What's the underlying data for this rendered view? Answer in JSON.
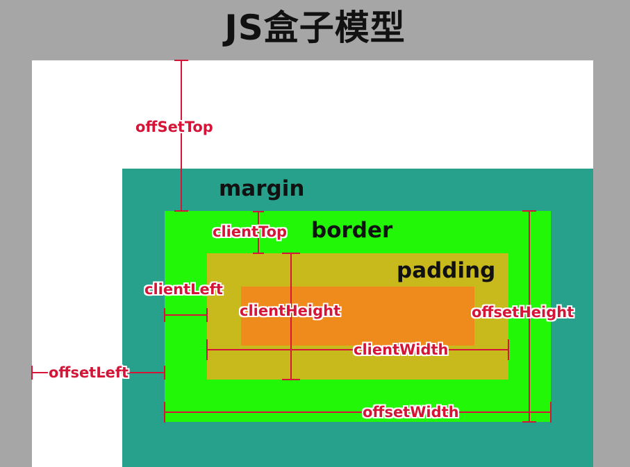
{
  "title": "JS盒子模型",
  "regions": {
    "margin": "margin",
    "border": "border",
    "padding": "padding"
  },
  "measurements": {
    "offset_top": "offSetTop",
    "client_top": "clientTop",
    "client_left": "clientLeft",
    "client_height": "clientHeight",
    "offset_height": "offsetHeight",
    "client_width": "clientWidth",
    "offset_left": "offsetLeft",
    "offset_width": "offsetWidth"
  },
  "colors": {
    "background": "#a6a6a6",
    "document": "#ffffff",
    "margin": "#27a18c",
    "border": "#22f707",
    "padding": "#c8b91c",
    "content": "#ef8a1d",
    "measure_line": "#d41538"
  }
}
